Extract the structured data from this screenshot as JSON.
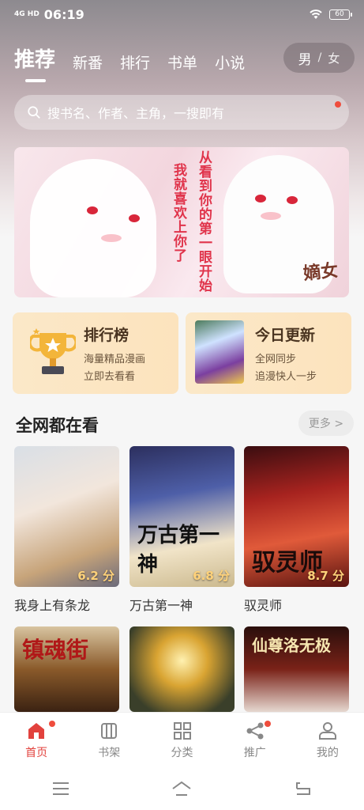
{
  "status": {
    "signal": "4G HD",
    "time": "06:19",
    "battery": "60"
  },
  "nav": {
    "tabs": [
      "推荐",
      "新番",
      "排行",
      "书单",
      "小说"
    ],
    "active": "推荐",
    "gender": {
      "male": "男",
      "sep": "/",
      "female": "女"
    }
  },
  "search": {
    "placeholder": "搜书名、作者、主角，一搜即有"
  },
  "banner": {
    "quote1": "我就喜欢上你了",
    "quote2": "从看到你的第一眼开始",
    "title_art": "嫡女"
  },
  "cards": {
    "ranking": {
      "title": "排行榜",
      "line1": "海量精品漫画",
      "line2": "立即去看看"
    },
    "update": {
      "title": "今日更新",
      "line1": "全网同步",
      "line2": "追漫快人一步"
    }
  },
  "section": {
    "title": "全网都在看",
    "more": "更多 >"
  },
  "books": [
    {
      "name": "我身上有条龙",
      "score": "6.2 分"
    },
    {
      "name": "万古第一神",
      "score": "6.8 分",
      "cover_text": "万古第一神"
    },
    {
      "name": "驭灵师",
      "score": "8.7 分",
      "cover_text": "驭灵师"
    },
    {
      "cover_text": "镇魂街"
    },
    {
      "cover_text": ""
    },
    {
      "cover_text": "仙尊洛无极"
    }
  ],
  "tabbar": [
    {
      "label": "首页",
      "icon": "home-icon"
    },
    {
      "label": "书架",
      "icon": "bookshelf-icon"
    },
    {
      "label": "分类",
      "icon": "category-icon"
    },
    {
      "label": "推广",
      "icon": "share-icon"
    },
    {
      "label": "我的",
      "icon": "profile-icon"
    }
  ],
  "colors": {
    "accent": "#e2423d",
    "card_bg": "#fce3bd"
  }
}
